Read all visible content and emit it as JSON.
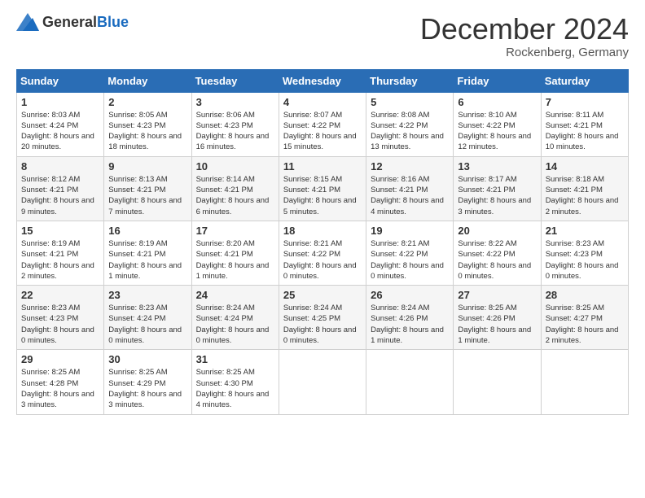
{
  "header": {
    "logo_general": "General",
    "logo_blue": "Blue",
    "month_title": "December 2024",
    "location": "Rockenberg, Germany"
  },
  "days_of_week": [
    "Sunday",
    "Monday",
    "Tuesday",
    "Wednesday",
    "Thursday",
    "Friday",
    "Saturday"
  ],
  "weeks": [
    [
      {
        "day": 1,
        "sunrise": "8:03 AM",
        "sunset": "4:24 PM",
        "daylight": "8 hours and 20 minutes."
      },
      {
        "day": 2,
        "sunrise": "8:05 AM",
        "sunset": "4:23 PM",
        "daylight": "8 hours and 18 minutes."
      },
      {
        "day": 3,
        "sunrise": "8:06 AM",
        "sunset": "4:23 PM",
        "daylight": "8 hours and 16 minutes."
      },
      {
        "day": 4,
        "sunrise": "8:07 AM",
        "sunset": "4:22 PM",
        "daylight": "8 hours and 15 minutes."
      },
      {
        "day": 5,
        "sunrise": "8:08 AM",
        "sunset": "4:22 PM",
        "daylight": "8 hours and 13 minutes."
      },
      {
        "day": 6,
        "sunrise": "8:10 AM",
        "sunset": "4:22 PM",
        "daylight": "8 hours and 12 minutes."
      },
      {
        "day": 7,
        "sunrise": "8:11 AM",
        "sunset": "4:21 PM",
        "daylight": "8 hours and 10 minutes."
      }
    ],
    [
      {
        "day": 8,
        "sunrise": "8:12 AM",
        "sunset": "4:21 PM",
        "daylight": "8 hours and 9 minutes."
      },
      {
        "day": 9,
        "sunrise": "8:13 AM",
        "sunset": "4:21 PM",
        "daylight": "8 hours and 7 minutes."
      },
      {
        "day": 10,
        "sunrise": "8:14 AM",
        "sunset": "4:21 PM",
        "daylight": "8 hours and 6 minutes."
      },
      {
        "day": 11,
        "sunrise": "8:15 AM",
        "sunset": "4:21 PM",
        "daylight": "8 hours and 5 minutes."
      },
      {
        "day": 12,
        "sunrise": "8:16 AM",
        "sunset": "4:21 PM",
        "daylight": "8 hours and 4 minutes."
      },
      {
        "day": 13,
        "sunrise": "8:17 AM",
        "sunset": "4:21 PM",
        "daylight": "8 hours and 3 minutes."
      },
      {
        "day": 14,
        "sunrise": "8:18 AM",
        "sunset": "4:21 PM",
        "daylight": "8 hours and 2 minutes."
      }
    ],
    [
      {
        "day": 15,
        "sunrise": "8:19 AM",
        "sunset": "4:21 PM",
        "daylight": "8 hours and 2 minutes."
      },
      {
        "day": 16,
        "sunrise": "8:19 AM",
        "sunset": "4:21 PM",
        "daylight": "8 hours and 1 minute."
      },
      {
        "day": 17,
        "sunrise": "8:20 AM",
        "sunset": "4:21 PM",
        "daylight": "8 hours and 1 minute."
      },
      {
        "day": 18,
        "sunrise": "8:21 AM",
        "sunset": "4:22 PM",
        "daylight": "8 hours and 0 minutes."
      },
      {
        "day": 19,
        "sunrise": "8:21 AM",
        "sunset": "4:22 PM",
        "daylight": "8 hours and 0 minutes."
      },
      {
        "day": 20,
        "sunrise": "8:22 AM",
        "sunset": "4:22 PM",
        "daylight": "8 hours and 0 minutes."
      },
      {
        "day": 21,
        "sunrise": "8:23 AM",
        "sunset": "4:23 PM",
        "daylight": "8 hours and 0 minutes."
      }
    ],
    [
      {
        "day": 22,
        "sunrise": "8:23 AM",
        "sunset": "4:23 PM",
        "daylight": "8 hours and 0 minutes."
      },
      {
        "day": 23,
        "sunrise": "8:23 AM",
        "sunset": "4:24 PM",
        "daylight": "8 hours and 0 minutes."
      },
      {
        "day": 24,
        "sunrise": "8:24 AM",
        "sunset": "4:24 PM",
        "daylight": "8 hours and 0 minutes."
      },
      {
        "day": 25,
        "sunrise": "8:24 AM",
        "sunset": "4:25 PM",
        "daylight": "8 hours and 0 minutes."
      },
      {
        "day": 26,
        "sunrise": "8:24 AM",
        "sunset": "4:26 PM",
        "daylight": "8 hours and 1 minute."
      },
      {
        "day": 27,
        "sunrise": "8:25 AM",
        "sunset": "4:26 PM",
        "daylight": "8 hours and 1 minute."
      },
      {
        "day": 28,
        "sunrise": "8:25 AM",
        "sunset": "4:27 PM",
        "daylight": "8 hours and 2 minutes."
      }
    ],
    [
      {
        "day": 29,
        "sunrise": "8:25 AM",
        "sunset": "4:28 PM",
        "daylight": "8 hours and 3 minutes."
      },
      {
        "day": 30,
        "sunrise": "8:25 AM",
        "sunset": "4:29 PM",
        "daylight": "8 hours and 3 minutes."
      },
      {
        "day": 31,
        "sunrise": "8:25 AM",
        "sunset": "4:30 PM",
        "daylight": "8 hours and 4 minutes."
      },
      null,
      null,
      null,
      null
    ]
  ],
  "labels": {
    "sunrise": "Sunrise:",
    "sunset": "Sunset:",
    "daylight": "Daylight:"
  }
}
